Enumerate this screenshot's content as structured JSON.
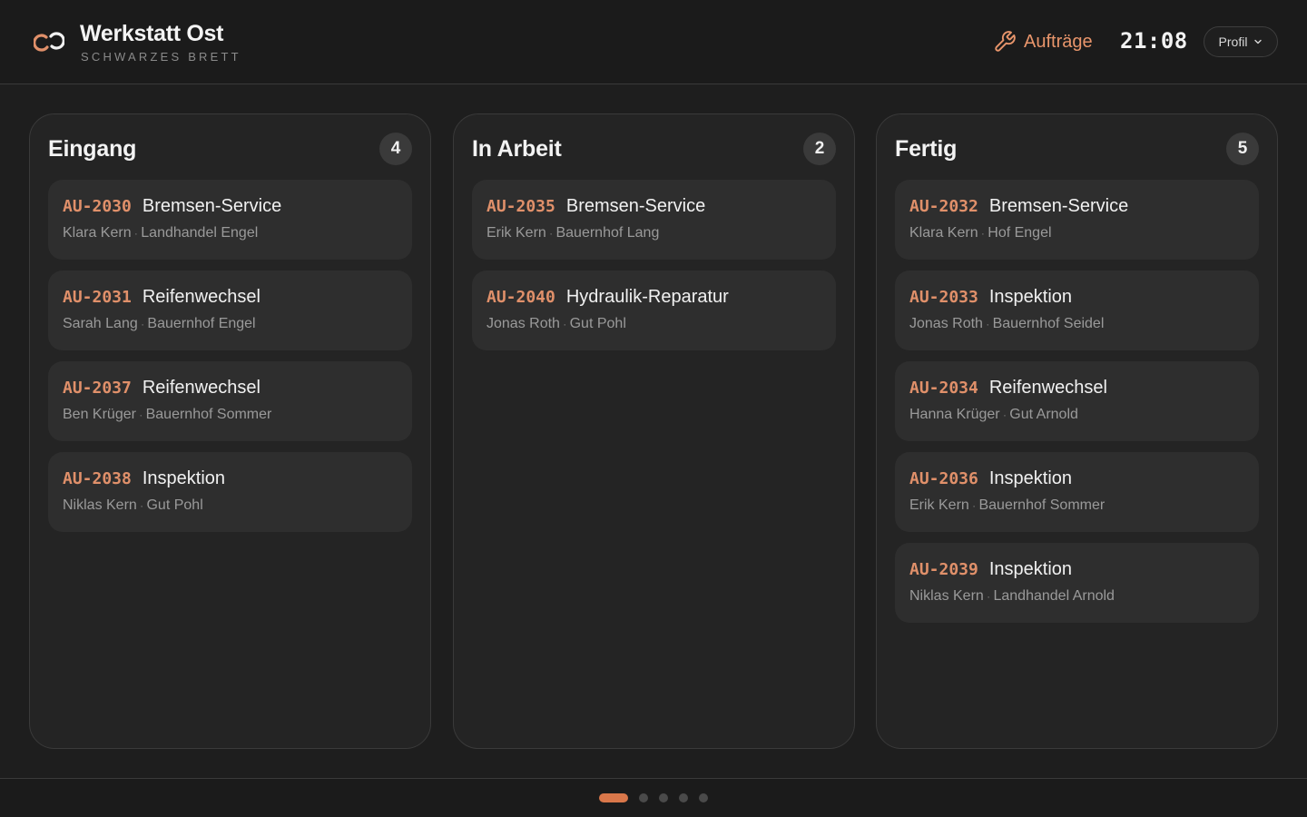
{
  "header": {
    "title": "Werkstatt Ost",
    "subtitle": "SCHWARZES BRETT",
    "nav_label": "Aufträge",
    "clock": "21:08",
    "profile_label": "Profil"
  },
  "colors": {
    "accent": "#e0906a",
    "pager_active": "#d9774a",
    "background": "#1e1e1e",
    "card": "#2e2e2e"
  },
  "icons": [
    "link-logo-icon",
    "wrench-icon",
    "chevron-down-icon"
  ],
  "columns": [
    {
      "title": "Eingang",
      "count": "4",
      "cards": [
        {
          "id": "AU-2030",
          "title": "Bremsen-Service",
          "person": "Klara Kern",
          "customer": "Landhandel Engel"
        },
        {
          "id": "AU-2031",
          "title": "Reifenwechsel",
          "person": "Sarah Lang",
          "customer": "Bauernhof Engel"
        },
        {
          "id": "AU-2037",
          "title": "Reifenwechsel",
          "person": "Ben Krüger",
          "customer": "Bauernhof Sommer"
        },
        {
          "id": "AU-2038",
          "title": "Inspektion",
          "person": "Niklas Kern",
          "customer": "Gut Pohl"
        }
      ]
    },
    {
      "title": "In Arbeit",
      "count": "2",
      "cards": [
        {
          "id": "AU-2035",
          "title": "Bremsen-Service",
          "person": "Erik Kern",
          "customer": "Bauernhof Lang"
        },
        {
          "id": "AU-2040",
          "title": "Hydraulik-Reparatur",
          "person": "Jonas Roth",
          "customer": "Gut Pohl"
        }
      ]
    },
    {
      "title": "Fertig",
      "count": "5",
      "cards": [
        {
          "id": "AU-2032",
          "title": "Bremsen-Service",
          "person": "Klara Kern",
          "customer": "Hof Engel"
        },
        {
          "id": "AU-2033",
          "title": "Inspektion",
          "person": "Jonas Roth",
          "customer": "Bauernhof Seidel"
        },
        {
          "id": "AU-2034",
          "title": "Reifenwechsel",
          "person": "Hanna Krüger",
          "customer": "Gut Arnold"
        },
        {
          "id": "AU-2036",
          "title": "Inspektion",
          "person": "Erik Kern",
          "customer": "Bauernhof Sommer"
        },
        {
          "id": "AU-2039",
          "title": "Inspektion",
          "person": "Niklas Kern",
          "customer": "Landhandel Arnold"
        }
      ]
    }
  ],
  "pager": {
    "pages": 5,
    "active_index": 0
  }
}
